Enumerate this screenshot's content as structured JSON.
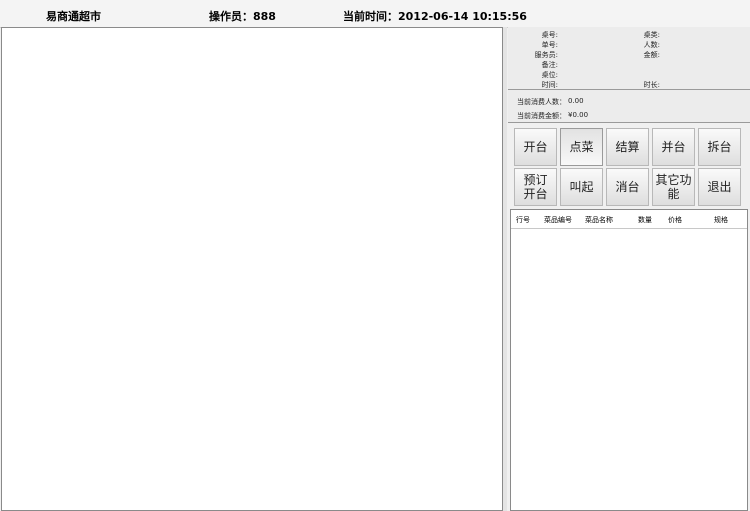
{
  "header": {
    "store_name": "易商通超市",
    "operator": "操作员：888",
    "current_time": "当前时间：2012-06-14 10:15:56"
  },
  "table_info": {
    "left_labels": [
      "桌号:",
      "单号:",
      "服务员:",
      "备注:",
      "桌位:",
      "时间:"
    ],
    "right_labels": [
      "桌类:",
      "人数:",
      "金额:",
      "时长:"
    ]
  },
  "consumption": {
    "people_label": "当前消费人数：",
    "people_value": "0.00",
    "amount_label": "当前消费金额：",
    "amount_value": "¥0.00"
  },
  "buttons": {
    "row1": [
      "开台",
      "点菜",
      "结算",
      "并台",
      "拆台"
    ],
    "row2": [
      "预订\n开台",
      "叫起",
      "消台",
      "其它功\n能",
      "退出"
    ]
  },
  "order_table": {
    "columns": [
      "行号",
      "菜品编号",
      "菜品名称",
      "数量",
      "价格",
      "规格"
    ]
  }
}
